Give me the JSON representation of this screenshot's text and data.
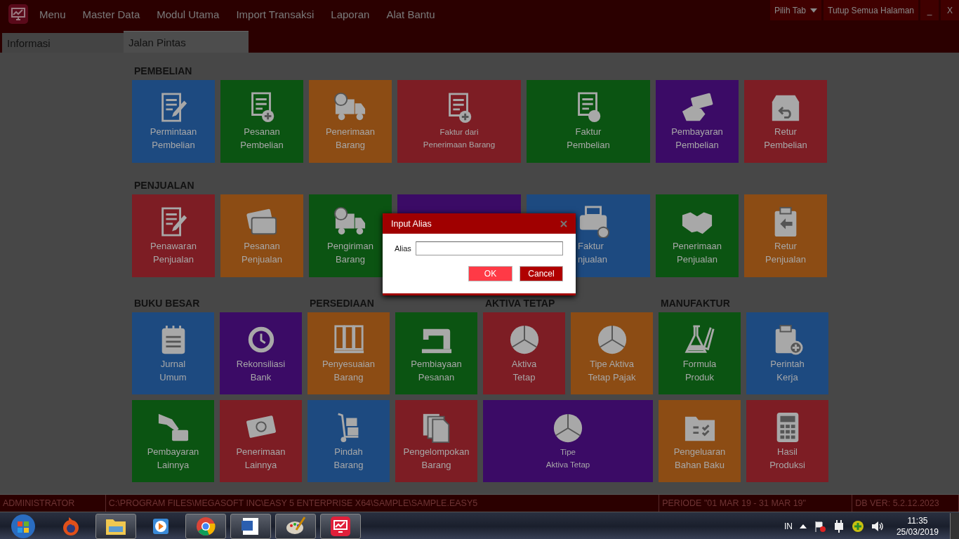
{
  "menu_bar": {
    "items": [
      "Menu",
      "Master Data",
      "Modul Utama",
      "Import Transaksi",
      "Laporan",
      "Alat Bantu"
    ],
    "right_buttons": [
      {
        "label": "Pilih Tab",
        "kind": "dropdown"
      },
      {
        "label": "Tutup Semua Halaman",
        "kind": "plain"
      },
      {
        "label": "_",
        "kind": "plain"
      },
      {
        "label": "X",
        "kind": "plain"
      }
    ]
  },
  "tabs": [
    {
      "label": "Informasi",
      "selected": false
    },
    {
      "label": "Jalan Pintas",
      "selected": true
    }
  ],
  "sections": [
    {
      "title": "PEMBELIAN",
      "tiles": [
        {
          "lines": [
            "Permintaan",
            "Pembelian"
          ],
          "color": "#1d4a80"
        },
        {
          "lines": [
            "Pesanan",
            "Pembelian"
          ],
          "color": "#0b5412"
        },
        {
          "lines": [
            "Penerimaan",
            "Barang"
          ],
          "color": "#8c4c14"
        },
        {
          "lines": [
            "Faktur dari",
            "Penerimaan Barang"
          ],
          "color": "#7d1d24",
          "wide": true
        },
        {
          "lines": [
            "Faktur",
            "Pembelian"
          ],
          "color": "#0b5412",
          "wide": true
        },
        {
          "lines": [
            "Pembayaran",
            "Pembelian"
          ],
          "color": "#3b0b66"
        },
        {
          "lines": [
            "Retur",
            "Pembelian"
          ],
          "color": "#7d1d24"
        }
      ]
    },
    {
      "title": "PENJUALAN",
      "tiles": [
        {
          "lines": [
            "Penawaran",
            "Penjualan"
          ],
          "color": "#7d1d24"
        },
        {
          "lines": [
            "Pesanan",
            "Penjualan"
          ],
          "color": "#8c4c14"
        },
        {
          "lines": [
            "Pengiriman",
            "Barang"
          ],
          "color": "#0b5412"
        },
        {
          "color": "#3b0b66",
          "wide": true
        },
        {
          "lines": [
            "Faktur",
            "njualan"
          ],
          "color": "#1d4a80",
          "wide": true
        },
        {
          "lines": [
            "Penerimaan",
            "Penjualan"
          ],
          "color": "#0b5412"
        },
        {
          "lines": [
            "Retur",
            "Penjualan"
          ],
          "color": "#8c4c14"
        }
      ]
    }
  ],
  "lower_sections": [
    {
      "title": "BUKU BESAR",
      "tiles": [
        {
          "lines": [
            "Jurnal",
            "Umum"
          ],
          "color": "#1d4a80"
        },
        {
          "lines": [
            "Rekonsiliasi",
            "Bank"
          ],
          "color": "#3b0b66"
        },
        {
          "lines": [
            "Pembayaran",
            "Lainnya"
          ],
          "color": "#0b5412"
        },
        {
          "lines": [
            "Penerimaan",
            "Lainnya"
          ],
          "color": "#7d1d24"
        }
      ]
    },
    {
      "title": "PERSEDIAAN",
      "tiles": [
        {
          "lines": [
            "Penyesuaian",
            "Barang"
          ],
          "color": "#8c4c14"
        },
        {
          "lines": [
            "Pembiayaan",
            "Pesanan"
          ],
          "color": "#0b5412"
        },
        {
          "lines": [
            "Pindah",
            "Barang"
          ],
          "color": "#1d4a80"
        },
        {
          "lines": [
            "Pengelompokan",
            "Barang"
          ],
          "color": "#7d1d24"
        }
      ]
    },
    {
      "title": "AKTIVA TETAP",
      "tiles": [
        {
          "lines": [
            "Aktiva",
            "Tetap"
          ],
          "color": "#7d1d24"
        },
        {
          "lines": [
            "Tipe Aktiva",
            "Tetap Pajak"
          ],
          "color": "#8c4c14"
        },
        {
          "lines": [
            "Tipe",
            "Aktiva Tetap"
          ],
          "color": "#3b0b66",
          "wide": true
        }
      ]
    },
    {
      "title": "MANUFAKTUR",
      "tiles": [
        {
          "lines": [
            "Formula",
            "Produk"
          ],
          "color": "#0b5412"
        },
        {
          "lines": [
            "Perintah",
            "Kerja"
          ],
          "color": "#1d4a80"
        },
        {
          "lines": [
            "Pengeluaran",
            "Bahan Baku"
          ],
          "color": "#8c4c14"
        },
        {
          "lines": [
            "Hasil",
            "Produksi"
          ],
          "color": "#7d1d24"
        }
      ]
    }
  ],
  "status_bar": [
    "ADMINISTRATOR",
    "C:\\PROGRAM FILES\\MEGASOFT INC\\EASY 5 ENTERPRISE X64\\SAMPLE\\SAMPLE.EASY5",
    "PERIODE \"01 MAR 19 - 31 MAR 19\"",
    "DB VER: 5.2.12.2023"
  ],
  "dialog": {
    "title": "Input Alias",
    "field_label": "Alias",
    "buttons": [
      {
        "label": "OK",
        "kind": "primary"
      },
      {
        "label": "Cancel",
        "kind": "secondary"
      }
    ]
  },
  "taskbar": {
    "apps": [
      {
        "running": false
      },
      {
        "running": true
      },
      {
        "running": false
      },
      {
        "running": true
      },
      {
        "running": true
      },
      {
        "running": true
      },
      {
        "running": true
      }
    ],
    "language": "IN",
    "time": "11:35",
    "date": "25/03/2019"
  }
}
